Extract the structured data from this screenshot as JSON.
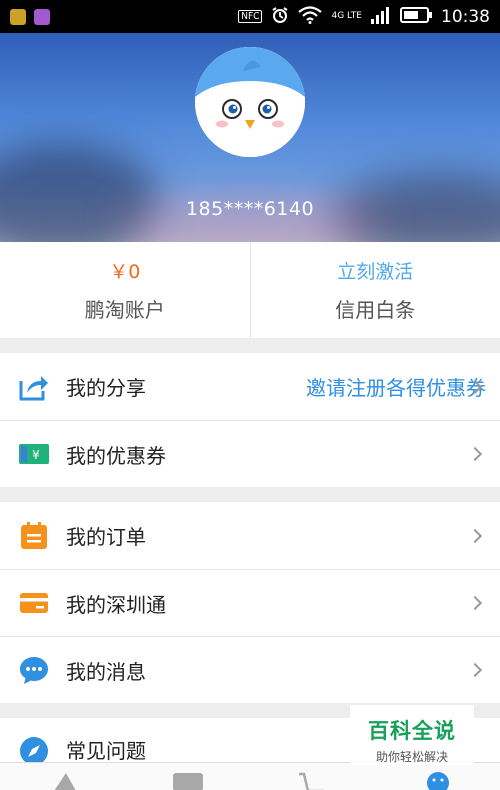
{
  "status_bar": {
    "nfc": "NFC",
    "network": "4G LTE",
    "time": "10:38"
  },
  "profile": {
    "phone": "185****6140"
  },
  "account": {
    "balance": "￥0",
    "balance_label": "鹏淘账户",
    "activate": "立刻激活",
    "activate_label": "信用白条"
  },
  "group1": [
    {
      "label": "我的分享",
      "extra": "邀请注册各得优惠券",
      "icon": "share-icon"
    },
    {
      "label": "我的优惠券",
      "extra": "",
      "icon": "coupon-icon"
    }
  ],
  "group2": [
    {
      "label": "我的订单",
      "icon": "order-icon"
    },
    {
      "label": "我的深圳通",
      "icon": "card-icon"
    },
    {
      "label": "我的消息",
      "icon": "message-icon"
    }
  ],
  "group3": [
    {
      "label": "常见问题",
      "icon": "compass-icon"
    }
  ],
  "watermark": {
    "title": "百科全说",
    "subtitle": "助你轻松解决"
  },
  "colors": {
    "accent_blue": "#2f8fe0",
    "balance_orange": "#f26a1b",
    "header_blue": "#4e86d8"
  }
}
